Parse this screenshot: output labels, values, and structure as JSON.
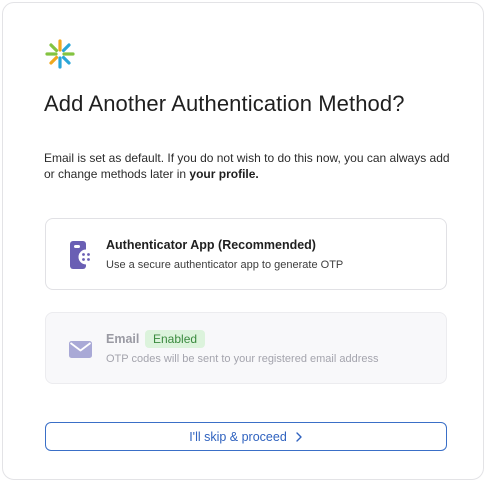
{
  "page": {
    "title": "Add Another Authentication Method?",
    "description_prefix": "Email is set as default. If you do not wish to do this now, you can always add or change methods later in ",
    "description_link": "your profile."
  },
  "methods": [
    {
      "title": "Authenticator App (Recommended)",
      "subtitle": "Use a secure authenticator app to generate OTP",
      "icon": "authenticator-app-icon"
    },
    {
      "title": "Email",
      "badge": "Enabled",
      "subtitle": "OTP codes will be sent to your registered email address",
      "icon": "envelope-icon"
    }
  ],
  "skip_button": {
    "label": "I'll skip & proceed",
    "icon": "chevron-right-icon"
  },
  "colors": {
    "accent": "#2f62bf",
    "app_icon": "#6a5fb4",
    "badge_bg": "#dcf3dc",
    "badge_text": "#3a8a3e"
  }
}
